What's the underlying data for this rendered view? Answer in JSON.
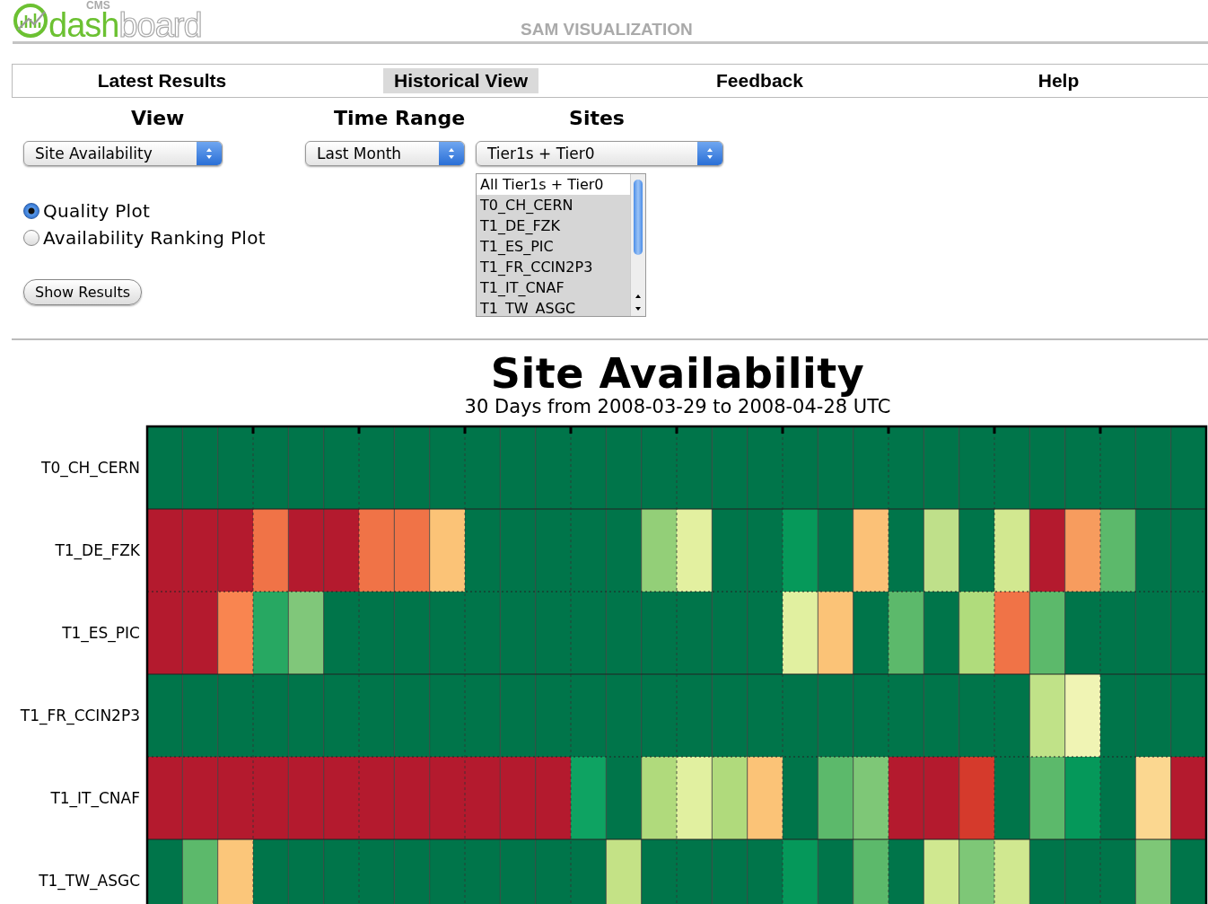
{
  "header": {
    "logo_small": "CMS",
    "logo_main": "dash",
    "logo_rest": "board",
    "page_title": "SAM VISUALIZATION"
  },
  "nav": [
    {
      "label": "Latest Results",
      "selected": false
    },
    {
      "label": "Historical View",
      "selected": true
    },
    {
      "label": "Feedback",
      "selected": false
    },
    {
      "label": "Help",
      "selected": false
    }
  ],
  "view": {
    "label": "View",
    "value": "Site Availability"
  },
  "time_range": {
    "label": "Time Range",
    "value": "Last Month"
  },
  "sites": {
    "label": "Sites",
    "value": "Tier1s + Tier0",
    "options": [
      {
        "label": "All Tier1s + Tier0",
        "selected": false
      },
      {
        "label": "T0_CH_CERN",
        "selected": true
      },
      {
        "label": "T1_DE_FZK",
        "selected": true
      },
      {
        "label": "T1_ES_PIC",
        "selected": true
      },
      {
        "label": "T1_FR_CCIN2P3",
        "selected": true
      },
      {
        "label": "T1_IT_CNAF",
        "selected": true
      },
      {
        "label": "T1_TW_ASGC",
        "selected": true
      }
    ]
  },
  "plot_types": [
    {
      "label": "Quality Plot",
      "selected": true
    },
    {
      "label": "Availability Ranking Plot",
      "selected": false
    }
  ],
  "show_button": "Show Results",
  "chart": {
    "title": "Site Availability",
    "subtitle": "30 Days from 2008-03-29 to  2008-04-28 UTC",
    "rows": [
      {
        "site": "T0_CH_CERN",
        "cells": [
          {
            "color": "#00754a"
          },
          {
            "color": "#00754a"
          },
          {
            "color": "#00754a"
          },
          {
            "color": "#00754a"
          },
          {
            "color": "#00754a"
          },
          {
            "color": "#00754a"
          },
          {
            "color": "#00754a"
          },
          {
            "color": "#00754a"
          },
          {
            "color": "#00754a"
          },
          {
            "color": "#00754a"
          },
          {
            "color": "#00754a"
          },
          {
            "color": "#00754a"
          },
          {
            "color": "#00754a"
          },
          {
            "color": "#00754a"
          },
          {
            "color": "#00754a"
          },
          {
            "color": "#00754a"
          },
          {
            "color": "#00754a"
          },
          {
            "color": "#00754a"
          },
          {
            "color": "#00754a"
          },
          {
            "color": "#00754a"
          },
          {
            "color": "#00754a"
          },
          {
            "color": "#00754a"
          },
          {
            "color": "#00754a"
          },
          {
            "color": "#00754a"
          },
          {
            "color": "#00754a"
          },
          {
            "color": "#00754a"
          },
          {
            "color": "#00754a"
          },
          {
            "color": "#00754a"
          },
          {
            "color": "#00754a"
          },
          {
            "color": "#00754a"
          }
        ]
      },
      {
        "site": "T1_DE_FZK",
        "cells": [
          {
            "color": "#b41a2e"
          },
          {
            "color": "#b41a2e"
          },
          {
            "color": "#b41a2e"
          },
          {
            "color": "#f07347"
          },
          {
            "color": "#b41a2e"
          },
          {
            "color": "#b41a2e"
          },
          {
            "color": "#f07347"
          },
          {
            "color": "#f07347"
          },
          {
            "color": "#fbc377"
          },
          {
            "color": "#00754a"
          },
          {
            "color": "#00754a"
          },
          {
            "color": "#00754a"
          },
          {
            "color": "#00754a"
          },
          {
            "color": "#00754a"
          },
          {
            "color": "#93cf78"
          },
          {
            "color": "#e3f0a0"
          },
          {
            "color": "#00754a"
          },
          {
            "color": "#00754a"
          },
          {
            "color": "#06995a"
          },
          {
            "color": "#00754a"
          },
          {
            "color": "#fbc177"
          },
          {
            "color": "#00754a"
          },
          {
            "color": "#bfe08a"
          },
          {
            "color": "#00754a"
          },
          {
            "color": "#d2e890"
          },
          {
            "color": "#b41a2e"
          },
          {
            "color": "#f79c5e"
          },
          {
            "color": "#5cb96b"
          },
          {
            "color": "#00754a"
          },
          {
            "color": "#00754a"
          }
        ]
      },
      {
        "site": "T1_ES_PIC",
        "cells": [
          {
            "color": "#b41a2e"
          },
          {
            "color": "#b41a2e"
          },
          {
            "color": "#f98550"
          },
          {
            "color": "#27a862"
          },
          {
            "color": "#80c77a"
          },
          {
            "color": "#00754a"
          },
          {
            "color": "#00754a"
          },
          {
            "color": "#00754a"
          },
          {
            "color": "#00754a"
          },
          {
            "color": "#00754a"
          },
          {
            "color": "#00754a"
          },
          {
            "color": "#00754a"
          },
          {
            "color": "#00754a"
          },
          {
            "color": "#00754a"
          },
          {
            "color": "#00754a"
          },
          {
            "color": "#00754a"
          },
          {
            "color": "#00754a"
          },
          {
            "color": "#00754a"
          },
          {
            "color": "#e1f0a0"
          },
          {
            "color": "#fbc377"
          },
          {
            "color": "#00754a"
          },
          {
            "color": "#5cb96b"
          },
          {
            "color": "#00754a"
          },
          {
            "color": "#b0dc7c"
          },
          {
            "color": "#f07347"
          },
          {
            "color": "#5cb96b"
          },
          {
            "color": "#00754a"
          },
          {
            "color": "#00754a"
          },
          {
            "color": "#00754a"
          },
          {
            "color": "#00754a"
          }
        ]
      },
      {
        "site": "T1_FR_CCIN2P3",
        "cells": [
          {
            "color": "#00754a"
          },
          {
            "color": "#00754a"
          },
          {
            "color": "#00754a"
          },
          {
            "color": "#00754a"
          },
          {
            "color": "#00754a"
          },
          {
            "color": "#00754a"
          },
          {
            "color": "#00754a"
          },
          {
            "color": "#00754a"
          },
          {
            "color": "#00754a"
          },
          {
            "color": "#00754a"
          },
          {
            "color": "#00754a"
          },
          {
            "color": "#00754a"
          },
          {
            "color": "#00754a"
          },
          {
            "color": "#00754a"
          },
          {
            "color": "#00754a"
          },
          {
            "color": "#00754a"
          },
          {
            "color": "#00754a"
          },
          {
            "color": "#00754a"
          },
          {
            "color": "#00754a"
          },
          {
            "color": "#00754a"
          },
          {
            "color": "#00754a"
          },
          {
            "color": "#00754a"
          },
          {
            "color": "#00754a"
          },
          {
            "color": "#00754a"
          },
          {
            "color": "#00754a"
          },
          {
            "color": "#c0e288"
          },
          {
            "color": "#f0f4b4"
          },
          {
            "color": "#00754a"
          },
          {
            "color": "#00754a"
          },
          {
            "color": "#00754a"
          }
        ]
      },
      {
        "site": "T1_IT_CNAF",
        "cells": [
          {
            "color": "#b41a2e"
          },
          {
            "color": "#b41a2e"
          },
          {
            "color": "#b41a2e"
          },
          {
            "color": "#b41a2e"
          },
          {
            "color": "#b41a2e"
          },
          {
            "color": "#b41a2e"
          },
          {
            "color": "#b41a2e"
          },
          {
            "color": "#b41a2e"
          },
          {
            "color": "#b41a2e"
          },
          {
            "color": "#b41a2e"
          },
          {
            "color": "#b41a2e"
          },
          {
            "color": "#b41a2e"
          },
          {
            "color": "#0ea362"
          },
          {
            "color": "#00754a"
          },
          {
            "color": "#b0da7c"
          },
          {
            "color": "#e1f0a0"
          },
          {
            "color": "#b0da7c"
          },
          {
            "color": "#fbc377"
          },
          {
            "color": "#00754a"
          },
          {
            "color": "#5cb96b"
          },
          {
            "color": "#7ec777"
          },
          {
            "color": "#b41a2e"
          },
          {
            "color": "#b41a2e"
          },
          {
            "color": "#d53a2c"
          },
          {
            "color": "#00754a"
          },
          {
            "color": "#5cb96b"
          },
          {
            "color": "#05985a"
          },
          {
            "color": "#00754a"
          },
          {
            "color": "#fbd790"
          },
          {
            "color": "#b41a2e"
          }
        ]
      },
      {
        "site": "T1_TW_ASGC",
        "cells": [
          {
            "color": "#00754a"
          },
          {
            "color": "#5cb96b"
          },
          {
            "color": "#fbc67a"
          },
          {
            "color": "#00754a"
          },
          {
            "color": "#00754a"
          },
          {
            "color": "#00754a"
          },
          {
            "color": "#00754a"
          },
          {
            "color": "#00754a"
          },
          {
            "color": "#00754a"
          },
          {
            "color": "#00754a"
          },
          {
            "color": "#00754a"
          },
          {
            "color": "#00754a"
          },
          {
            "color": "#00754a"
          },
          {
            "color": "#c4e286"
          },
          {
            "color": "#00754a"
          },
          {
            "color": "#00754a"
          },
          {
            "color": "#00754a"
          },
          {
            "color": "#00754a"
          },
          {
            "color": "#05985a"
          },
          {
            "color": "#00754a"
          },
          {
            "color": "#5cb96b"
          },
          {
            "color": "#00754a"
          },
          {
            "color": "#d0e890"
          },
          {
            "color": "#7ec777"
          },
          {
            "color": "#d0e890"
          },
          {
            "color": "#00754a"
          },
          {
            "color": "#00754a"
          },
          {
            "color": "#00754a"
          },
          {
            "color": "#7ec777"
          },
          {
            "color": "#00754a"
          }
        ]
      }
    ]
  }
}
